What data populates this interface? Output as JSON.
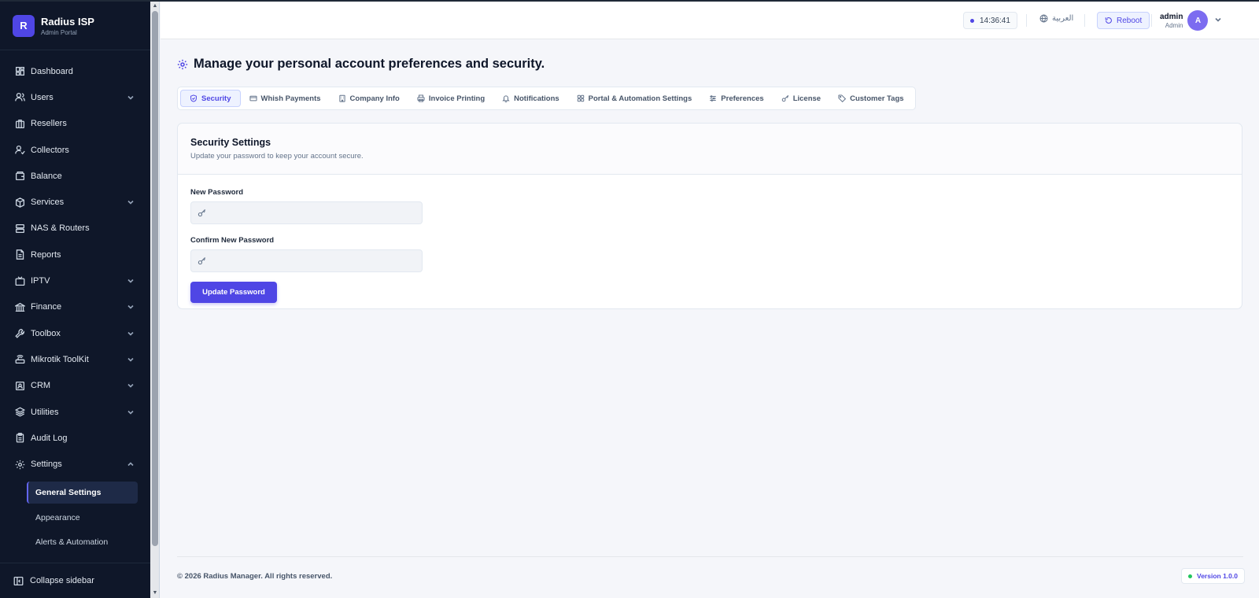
{
  "brand": {
    "logo_letter": "R",
    "title": "Radius ISP",
    "subtitle": "Admin Portal"
  },
  "sidebar": {
    "items": [
      {
        "label": "Dashboard",
        "icon": "dashboard-icon",
        "has_children": false
      },
      {
        "label": "Users",
        "icon": "users-icon",
        "has_children": true
      },
      {
        "label": "Resellers",
        "icon": "briefcase-icon",
        "has_children": false
      },
      {
        "label": "Collectors",
        "icon": "user-check-icon",
        "has_children": false
      },
      {
        "label": "Balance",
        "icon": "wallet-icon",
        "has_children": false
      },
      {
        "label": "Services",
        "icon": "box-icon",
        "has_children": true
      },
      {
        "label": "NAS & Routers",
        "icon": "server-icon",
        "has_children": false
      },
      {
        "label": "Reports",
        "icon": "file-icon",
        "has_children": false
      },
      {
        "label": "IPTV",
        "icon": "tv-icon",
        "has_children": true
      },
      {
        "label": "Finance",
        "icon": "bank-icon",
        "has_children": true
      },
      {
        "label": "Toolbox",
        "icon": "wrench-icon",
        "has_children": true
      },
      {
        "label": "Mikrotik ToolKit",
        "icon": "router-icon",
        "has_children": true
      },
      {
        "label": "CRM",
        "icon": "contact-icon",
        "has_children": true
      },
      {
        "label": "Utilities",
        "icon": "layers-icon",
        "has_children": true
      },
      {
        "label": "Audit Log",
        "icon": "clipboard-icon",
        "has_children": false
      },
      {
        "label": "Settings",
        "icon": "gear-icon",
        "has_children": true,
        "expanded": true
      }
    ],
    "settings_sub": [
      "General Settings",
      "Appearance",
      "Alerts & Automation"
    ],
    "active_sub": "General Settings",
    "collapse_label": "Collapse sidebar"
  },
  "header": {
    "clock": "14:36:41",
    "language": "العربية",
    "reboot_label": "Reboot",
    "user_name": "admin",
    "user_role": "Admin",
    "avatar_letter": "A"
  },
  "main": {
    "title": "Manage your personal account preferences and security.",
    "tabs": [
      {
        "label": "Security",
        "icon": "shield-icon",
        "active": true
      },
      {
        "label": "Whish Payments",
        "icon": "card-icon",
        "active": false
      },
      {
        "label": "Company Info",
        "icon": "building-icon",
        "active": false
      },
      {
        "label": "Invoice Printing",
        "icon": "printer-icon",
        "active": false
      },
      {
        "label": "Notifications",
        "icon": "bell-icon",
        "active": false
      },
      {
        "label": "Portal & Automation Settings",
        "icon": "grid-icon",
        "active": false
      },
      {
        "label": "Preferences",
        "icon": "sliders-icon",
        "active": false
      },
      {
        "label": "License",
        "icon": "key-icon",
        "active": false
      },
      {
        "label": "Customer Tags",
        "icon": "tag-icon",
        "active": false
      }
    ],
    "card": {
      "title": "Security Settings",
      "description": "Update your password to keep your account secure.",
      "new_password_label": "New Password",
      "new_password_value": "",
      "confirm_password_label": "Confirm New Password",
      "confirm_password_value": "",
      "submit_label": "Update Password"
    }
  },
  "footer": {
    "copyright": "© 2026 Radius Manager. All rights reserved.",
    "version": "Version 1.0.0"
  },
  "colors": {
    "accent": "#4f46e5",
    "sidebar_bg": "#0f1729",
    "page_bg": "#f5f6fa",
    "status_ok": "#22c55e"
  }
}
